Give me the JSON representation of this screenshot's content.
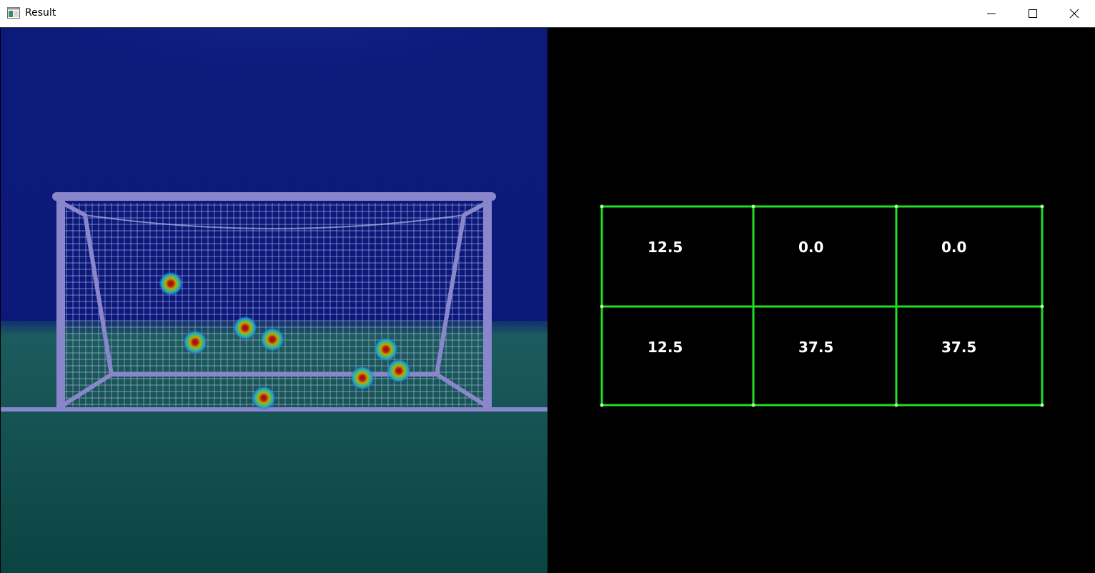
{
  "window": {
    "title": "Result",
    "icon": "app-window-icon",
    "controls": [
      "minimize-icon",
      "maximize-icon",
      "close-icon"
    ]
  },
  "scene": {
    "description_icon": "goal-net-heatmap",
    "colors": {
      "sky_top": "#0a1a7a",
      "sky_glow": "#3a55b8",
      "field": "#1a5a5e",
      "field_bottom": "#0a4a48",
      "goal_frame": "#8a86cc",
      "net": "#c8c8f0"
    },
    "heat_spots": [
      {
        "id": 1
      },
      {
        "id": 2
      },
      {
        "id": 3
      },
      {
        "id": 4
      },
      {
        "id": 5
      },
      {
        "id": 6
      },
      {
        "id": 7
      },
      {
        "id": 8
      }
    ]
  },
  "grid": {
    "line_color": "#22dd22",
    "text_color": "#ffffff",
    "rows": [
      [
        "12.5",
        "0.0",
        "0.0"
      ],
      [
        "12.5",
        "37.5",
        "37.5"
      ]
    ]
  }
}
